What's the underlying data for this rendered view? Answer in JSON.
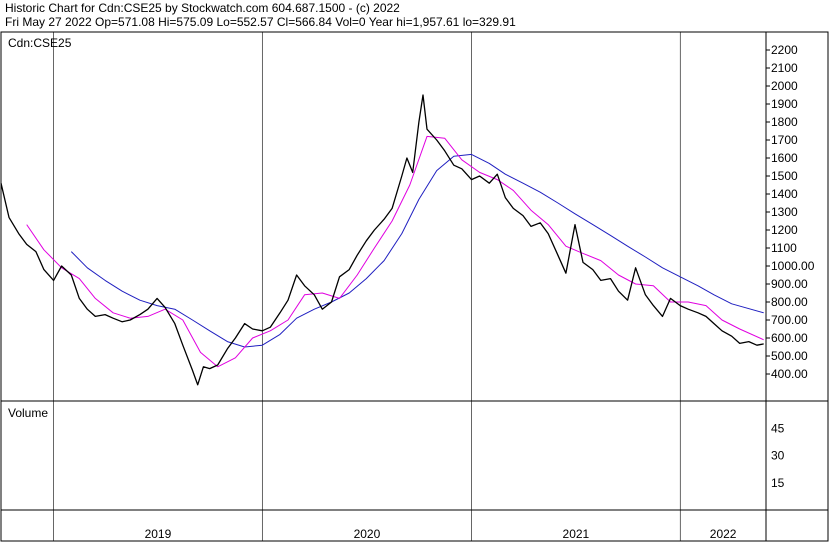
{
  "header": {
    "line1": "Historic Chart for Cdn:CSE25 by Stockwatch.com 604.687.1500 - (c) 2022",
    "line2": "Fri May 27 2022   Op=571.08   Hi=575.09   Lo=552.57   Cl=566.84   Vol=0   Year hi=1,957.61   lo=329.91"
  },
  "price_panel": {
    "symbol_label": "Cdn:CSE25"
  },
  "volume_panel": {
    "label": "Volume"
  },
  "colors": {
    "price": "#000000",
    "ma_short": "#e000e0",
    "ma_long": "#1f1fc0",
    "border": "#000000",
    "grid": "#000000"
  },
  "chart_data": [
    {
      "type": "line",
      "title": "Cdn:CSE25",
      "ylim": [
        250,
        2300
      ],
      "yticks": [
        400,
        500,
        600,
        700,
        800,
        900,
        1000,
        1100,
        1200,
        1300,
        1400,
        1500,
        1600,
        1700,
        1800,
        1900,
        2000,
        2100,
        2200
      ],
      "ytick_labels": [
        "400.00",
        "500.00",
        "600.00",
        "700.00",
        "800.00",
        "900.00",
        "1000.00",
        "1100",
        "1200",
        "1300",
        "1400",
        "1500",
        "1600",
        "1700",
        "1800",
        "1900",
        "2000",
        "2100",
        "2200"
      ],
      "x_labels": [
        "2019",
        "2020",
        "2021",
        "2022"
      ],
      "x_start": "2018-10-01",
      "x_end": "2022-05-31",
      "x_boundaries": [
        "2019-01-01",
        "2020-01-01",
        "2021-01-01",
        "2022-01-01"
      ],
      "series": [
        {
          "role": "price",
          "points": [
            [
              "2018-10-01",
              1460
            ],
            [
              "2018-10-15",
              1270
            ],
            [
              "2018-11-01",
              1180
            ],
            [
              "2018-11-15",
              1120
            ],
            [
              "2018-12-01",
              1080
            ],
            [
              "2018-12-15",
              980
            ],
            [
              "2019-01-01",
              920
            ],
            [
              "2019-01-15",
              1000
            ],
            [
              "2019-02-01",
              950
            ],
            [
              "2019-02-15",
              820
            ],
            [
              "2019-03-01",
              760
            ],
            [
              "2019-03-15",
              720
            ],
            [
              "2019-04-01",
              730
            ],
            [
              "2019-04-15",
              710
            ],
            [
              "2019-05-01",
              690
            ],
            [
              "2019-05-15",
              700
            ],
            [
              "2019-06-01",
              730
            ],
            [
              "2019-06-15",
              760
            ],
            [
              "2019-07-01",
              820
            ],
            [
              "2019-07-15",
              770
            ],
            [
              "2019-08-01",
              680
            ],
            [
              "2019-08-15",
              560
            ],
            [
              "2019-09-01",
              420
            ],
            [
              "2019-09-10",
              340
            ],
            [
              "2019-09-20",
              440
            ],
            [
              "2019-10-01",
              430
            ],
            [
              "2019-10-15",
              450
            ],
            [
              "2019-11-01",
              540
            ],
            [
              "2019-11-15",
              600
            ],
            [
              "2019-12-01",
              680
            ],
            [
              "2019-12-15",
              650
            ],
            [
              "2020-01-01",
              640
            ],
            [
              "2020-01-15",
              660
            ],
            [
              "2020-02-01",
              740
            ],
            [
              "2020-02-15",
              810
            ],
            [
              "2020-03-01",
              950
            ],
            [
              "2020-03-15",
              890
            ],
            [
              "2020-04-01",
              840
            ],
            [
              "2020-04-15",
              760
            ],
            [
              "2020-05-01",
              800
            ],
            [
              "2020-05-15",
              940
            ],
            [
              "2020-06-01",
              980
            ],
            [
              "2020-06-15",
              1060
            ],
            [
              "2020-07-01",
              1140
            ],
            [
              "2020-07-15",
              1200
            ],
            [
              "2020-08-01",
              1260
            ],
            [
              "2020-08-15",
              1320
            ],
            [
              "2020-09-01",
              1500
            ],
            [
              "2020-09-10",
              1600
            ],
            [
              "2020-09-20",
              1520
            ],
            [
              "2020-10-01",
              1800
            ],
            [
              "2020-10-08",
              1950
            ],
            [
              "2020-10-15",
              1760
            ],
            [
              "2020-11-01",
              1700
            ],
            [
              "2020-11-15",
              1640
            ],
            [
              "2020-12-01",
              1560
            ],
            [
              "2020-12-15",
              1540
            ],
            [
              "2021-01-01",
              1480
            ],
            [
              "2021-01-15",
              1500
            ],
            [
              "2021-02-01",
              1460
            ],
            [
              "2021-02-15",
              1510
            ],
            [
              "2021-03-01",
              1380
            ],
            [
              "2021-03-15",
              1320
            ],
            [
              "2021-04-01",
              1280
            ],
            [
              "2021-04-15",
              1220
            ],
            [
              "2021-05-01",
              1240
            ],
            [
              "2021-05-15",
              1180
            ],
            [
              "2021-06-01",
              1060
            ],
            [
              "2021-06-15",
              960
            ],
            [
              "2021-07-01",
              1230
            ],
            [
              "2021-07-15",
              1020
            ],
            [
              "2021-08-01",
              980
            ],
            [
              "2021-08-15",
              920
            ],
            [
              "2021-09-01",
              930
            ],
            [
              "2021-09-15",
              860
            ],
            [
              "2021-10-01",
              810
            ],
            [
              "2021-10-15",
              990
            ],
            [
              "2021-11-01",
              840
            ],
            [
              "2021-11-15",
              780
            ],
            [
              "2021-12-01",
              720
            ],
            [
              "2021-12-15",
              820
            ],
            [
              "2022-01-01",
              780
            ],
            [
              "2022-01-15",
              760
            ],
            [
              "2022-02-01",
              740
            ],
            [
              "2022-02-15",
              720
            ],
            [
              "2022-03-01",
              680
            ],
            [
              "2022-03-15",
              640
            ],
            [
              "2022-04-01",
              610
            ],
            [
              "2022-04-15",
              570
            ],
            [
              "2022-05-01",
              580
            ],
            [
              "2022-05-15",
              560
            ],
            [
              "2022-05-27",
              567
            ]
          ]
        },
        {
          "role": "moving_average_short",
          "points": [
            [
              "2018-11-15",
              1230
            ],
            [
              "2018-12-15",
              1090
            ],
            [
              "2019-01-15",
              990
            ],
            [
              "2019-02-15",
              930
            ],
            [
              "2019-03-15",
              820
            ],
            [
              "2019-04-15",
              740
            ],
            [
              "2019-05-15",
              710
            ],
            [
              "2019-06-15",
              720
            ],
            [
              "2019-07-15",
              760
            ],
            [
              "2019-08-15",
              700
            ],
            [
              "2019-09-15",
              520
            ],
            [
              "2019-10-15",
              440
            ],
            [
              "2019-11-15",
              490
            ],
            [
              "2019-12-15",
              600
            ],
            [
              "2020-01-15",
              640
            ],
            [
              "2020-02-15",
              700
            ],
            [
              "2020-03-15",
              840
            ],
            [
              "2020-04-15",
              850
            ],
            [
              "2020-05-15",
              820
            ],
            [
              "2020-06-15",
              950
            ],
            [
              "2020-07-15",
              1100
            ],
            [
              "2020-08-15",
              1250
            ],
            [
              "2020-09-15",
              1450
            ],
            [
              "2020-10-15",
              1720
            ],
            [
              "2020-11-15",
              1710
            ],
            [
              "2020-12-15",
              1590
            ],
            [
              "2021-01-15",
              1520
            ],
            [
              "2021-02-15",
              1480
            ],
            [
              "2021-03-15",
              1420
            ],
            [
              "2021-04-15",
              1310
            ],
            [
              "2021-05-15",
              1230
            ],
            [
              "2021-06-15",
              1110
            ],
            [
              "2021-07-15",
              1070
            ],
            [
              "2021-08-15",
              1030
            ],
            [
              "2021-09-15",
              950
            ],
            [
              "2021-10-15",
              900
            ],
            [
              "2021-11-15",
              890
            ],
            [
              "2021-12-15",
              800
            ],
            [
              "2022-01-15",
              800
            ],
            [
              "2022-02-15",
              780
            ],
            [
              "2022-03-15",
              700
            ],
            [
              "2022-04-15",
              650
            ],
            [
              "2022-05-27",
              590
            ]
          ]
        },
        {
          "role": "moving_average_long",
          "points": [
            [
              "2019-02-01",
              1080
            ],
            [
              "2019-03-01",
              990
            ],
            [
              "2019-04-01",
              920
            ],
            [
              "2019-05-01",
              860
            ],
            [
              "2019-06-01",
              810
            ],
            [
              "2019-07-01",
              780
            ],
            [
              "2019-08-01",
              760
            ],
            [
              "2019-09-01",
              700
            ],
            [
              "2019-10-01",
              640
            ],
            [
              "2019-11-01",
              580
            ],
            [
              "2019-12-01",
              550
            ],
            [
              "2020-01-01",
              560
            ],
            [
              "2020-02-01",
              620
            ],
            [
              "2020-03-01",
              710
            ],
            [
              "2020-04-01",
              760
            ],
            [
              "2020-05-01",
              800
            ],
            [
              "2020-06-01",
              850
            ],
            [
              "2020-07-01",
              930
            ],
            [
              "2020-08-01",
              1030
            ],
            [
              "2020-09-01",
              1180
            ],
            [
              "2020-10-01",
              1370
            ],
            [
              "2020-11-01",
              1530
            ],
            [
              "2020-12-01",
              1610
            ],
            [
              "2021-01-01",
              1620
            ],
            [
              "2021-02-01",
              1570
            ],
            [
              "2021-03-01",
              1510
            ],
            [
              "2021-04-01",
              1460
            ],
            [
              "2021-05-01",
              1410
            ],
            [
              "2021-06-01",
              1350
            ],
            [
              "2021-07-01",
              1290
            ],
            [
              "2021-08-01",
              1230
            ],
            [
              "2021-09-01",
              1170
            ],
            [
              "2021-10-01",
              1110
            ],
            [
              "2021-11-01",
              1050
            ],
            [
              "2021-12-01",
              990
            ],
            [
              "2022-01-01",
              940
            ],
            [
              "2022-02-01",
              890
            ],
            [
              "2022-03-01",
              840
            ],
            [
              "2022-04-01",
              790
            ],
            [
              "2022-05-27",
              740
            ]
          ]
        }
      ]
    },
    {
      "type": "bar",
      "title": "Volume",
      "ylim": [
        0,
        60
      ],
      "yticks": [
        15,
        30,
        45
      ],
      "ytick_labels": [
        "15",
        "30",
        "45"
      ],
      "values": []
    }
  ]
}
